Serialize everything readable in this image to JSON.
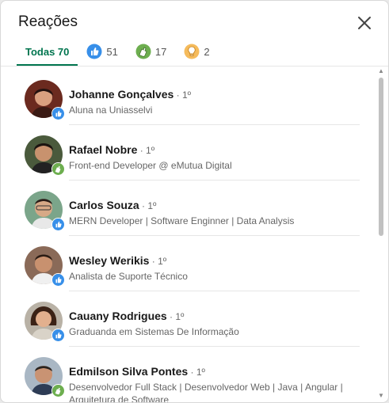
{
  "dialog": {
    "title": "Reações",
    "close_icon": "close-icon"
  },
  "tabs": [
    {
      "label": "Todas 70",
      "active": true
    },
    {
      "icon": "like-icon",
      "count": "51"
    },
    {
      "icon": "celebrate-icon",
      "count": "17"
    },
    {
      "icon": "insightful-icon",
      "count": "2"
    }
  ],
  "colors": {
    "accent": "#01754f",
    "like": "#378fe9",
    "celebrate": "#44712e",
    "insightful": "#f5bb5c"
  },
  "reactions": [
    {
      "name": "Johanne Gonçalves",
      "degree": " · 1º",
      "headline": "Aluna na Uniasselvi",
      "reaction": "like"
    },
    {
      "name": "Rafael Nobre",
      "degree": " · 1º",
      "headline": "Front-end Developer @ eMutua Digital",
      "reaction": "celebrate"
    },
    {
      "name": "Carlos Souza",
      "degree": " · 1º",
      "headline": "MERN Developer | Software Enginner | Data Analysis",
      "reaction": "like"
    },
    {
      "name": "Wesley Werikis",
      "degree": " · 1º",
      "headline": "Analista de Suporte Técnico",
      "reaction": "like"
    },
    {
      "name": "Cauany Rodrigues",
      "degree": " · 1º",
      "headline": "Graduanda em Sistemas De Informação",
      "reaction": "like"
    },
    {
      "name": "Edmilson Silva Pontes",
      "degree": " · 1º",
      "headline": "Desenvolvedor Full Stack | Desenvolvedor Web | Java | Angular | Arquitetura de Software",
      "reaction": "celebrate"
    }
  ]
}
